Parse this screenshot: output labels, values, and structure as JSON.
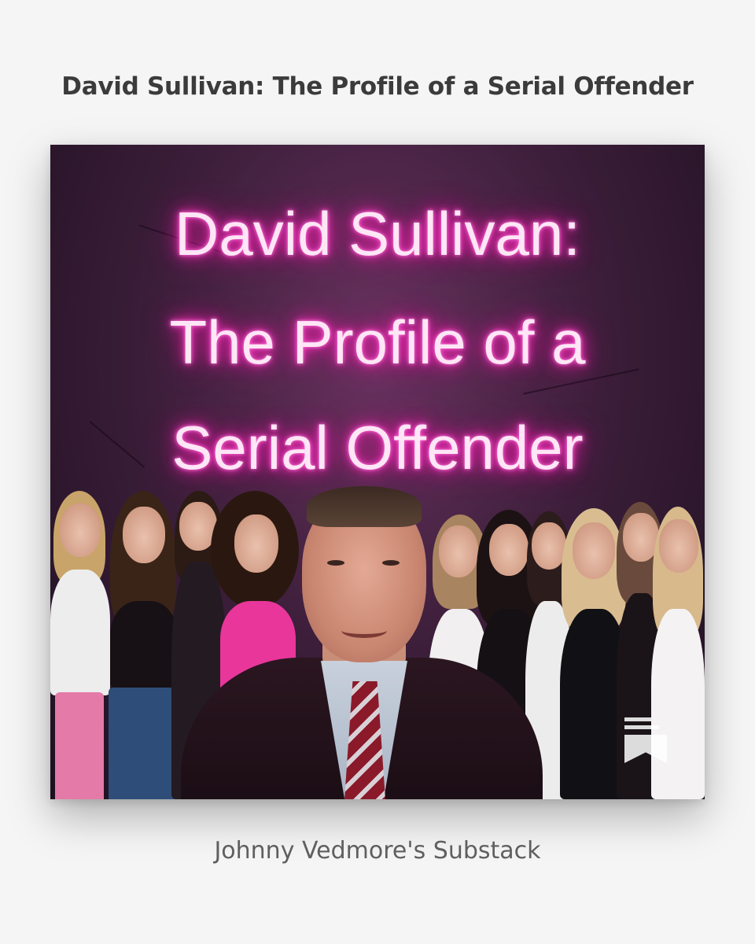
{
  "post": {
    "title": "David Sullivan: The Profile of a Serial Offender",
    "publication_name": "Johnny Vedmore's Substack"
  },
  "cover": {
    "neon_lines": [
      "David Sullivan:",
      "The Profile of a",
      "Serial Offender"
    ],
    "neon_color": "#ff3ec8",
    "background_color": "#3c1e3a"
  },
  "icons": {
    "publisher_mark": "substack-bookmark-icon"
  }
}
